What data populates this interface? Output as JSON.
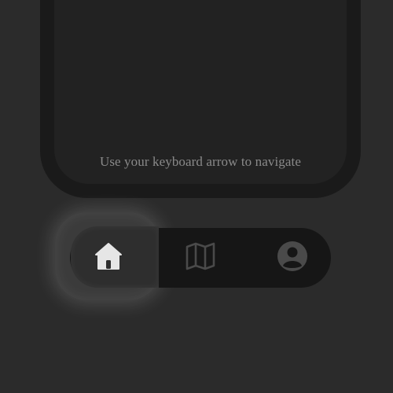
{
  "screen": {
    "hint_text": "Use your keyboard arrow to navigate"
  },
  "nav": {
    "active_item": "home",
    "items": [
      {
        "id": "home",
        "icon": "home-icon",
        "active": true
      },
      {
        "id": "map",
        "icon": "map-icon",
        "active": false
      },
      {
        "id": "profile",
        "icon": "user-circle-icon",
        "active": false
      }
    ]
  },
  "colors": {
    "background": "#2b2b2b",
    "frame": "#1a1a1a",
    "screen": "#222222",
    "nav_bar": "#161616",
    "icon_active": "#e6e6e6",
    "icon_inactive": "#4a4a4a",
    "hint_text": "#8a8a8a"
  }
}
